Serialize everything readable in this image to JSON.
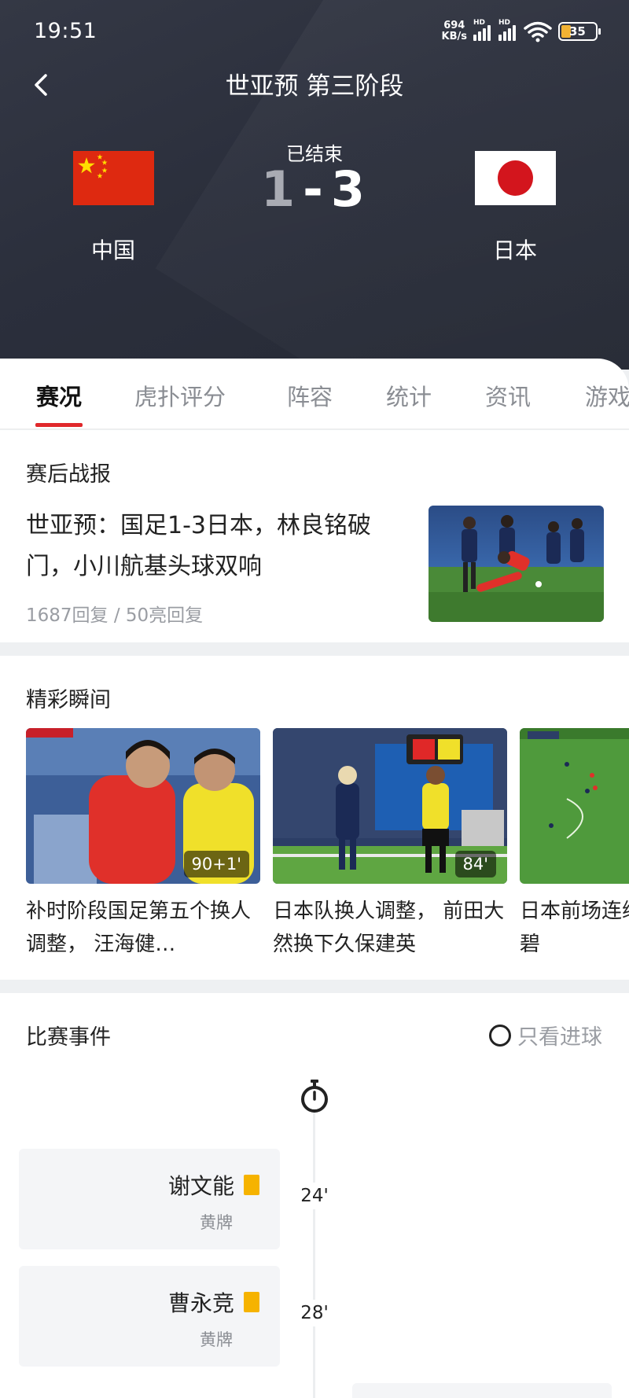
{
  "status_bar": {
    "time": "19:51",
    "net_speed_value": "694",
    "net_speed_unit": "KB/s",
    "signal_label": "HD",
    "battery_level": "35"
  },
  "header": {
    "title": "世亚预 第三阶段",
    "home_team": "中国",
    "away_team": "日本",
    "match_status": "已结束",
    "home_score": "1",
    "score_separator": "-",
    "away_score": "3"
  },
  "tabs": [
    {
      "label": "赛况",
      "active": true
    },
    {
      "label": "虎扑评分",
      "active": false
    },
    {
      "label": "阵容",
      "active": false
    },
    {
      "label": "统计",
      "active": false
    },
    {
      "label": "资讯",
      "active": false
    },
    {
      "label": "游戏",
      "active": false
    }
  ],
  "report": {
    "section_title": "赛后战报",
    "headline": "世亚预：国足1-3日本，林良铭破门，小川航基头球双响",
    "meta": "1687回复 / 50亮回复"
  },
  "highlights": {
    "section_title": "精彩瞬间",
    "items": [
      {
        "minute": "90+1'",
        "caption": "补时阶段国足第五个换人调整， 汪海健…"
      },
      {
        "minute": "84'",
        "caption": "日本队换人调整， 前田大然换下久保建英"
      },
      {
        "minute": "",
        "caption": "日本前场连续配合，田中碧"
      }
    ]
  },
  "events": {
    "section_title": "比赛事件",
    "filter_label": "只看进球",
    "items": [
      {
        "player": "谢文能",
        "type": "黄牌",
        "minute": "24'"
      },
      {
        "player": "曹永竞",
        "type": "黄牌",
        "minute": "28'"
      }
    ]
  },
  "colors": {
    "accent": "#e0282b",
    "header_bg": "#2b2f3c",
    "yellow_card": "#f6b300"
  }
}
